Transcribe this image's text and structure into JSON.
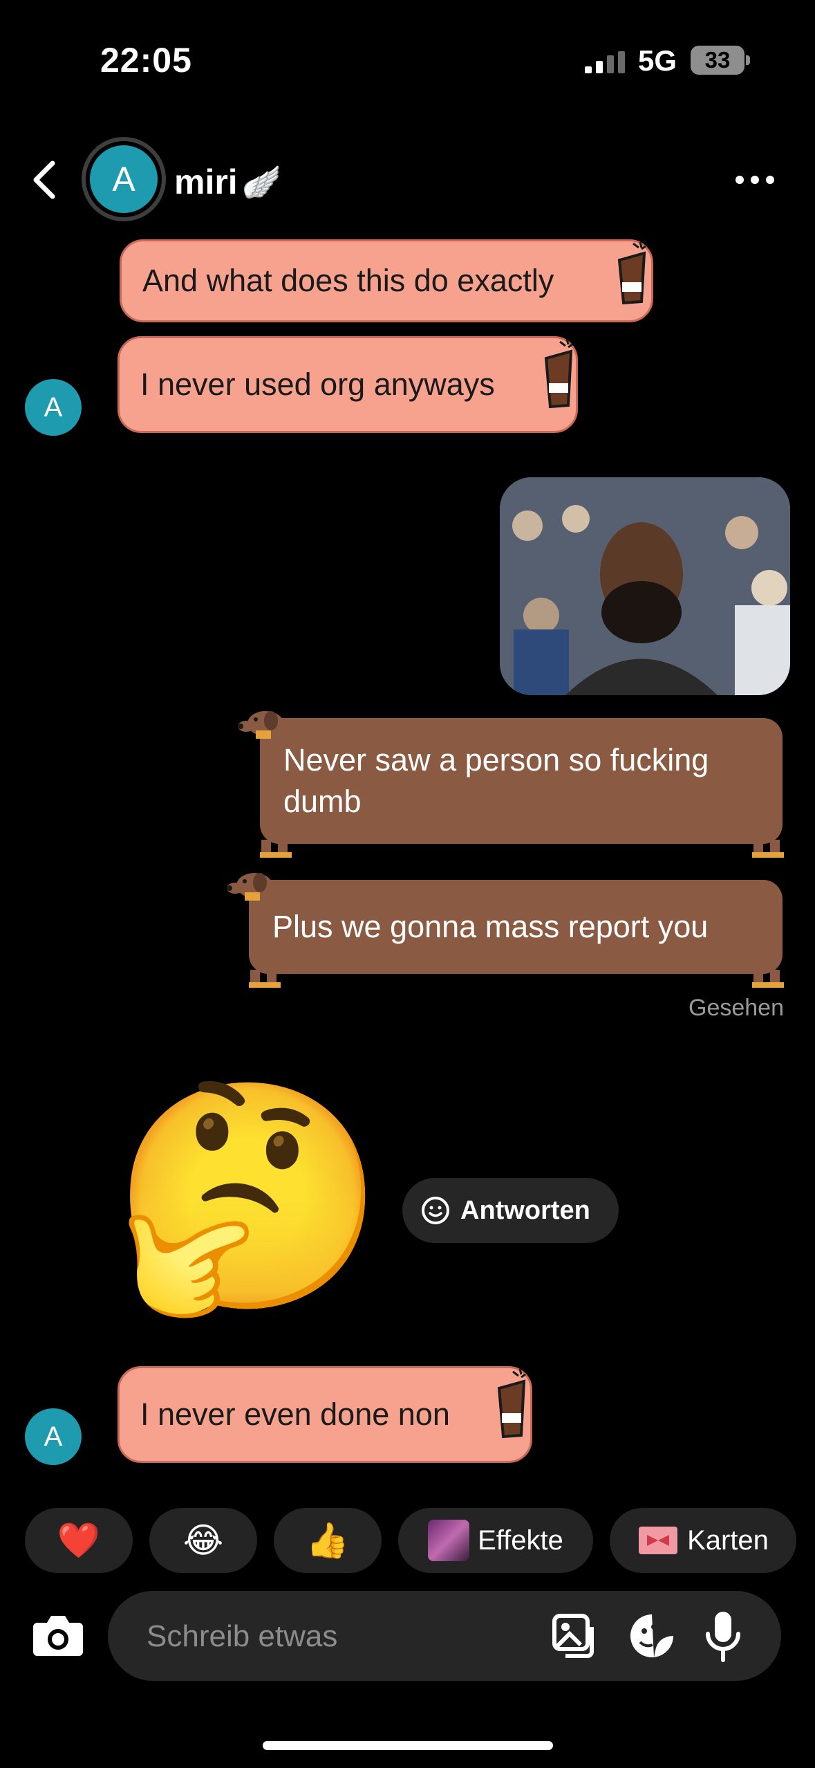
{
  "status_bar": {
    "time": "22:05",
    "network": "5G",
    "battery": "33"
  },
  "header": {
    "avatar_letter": "A",
    "contact_name": "miri",
    "name_emoji": "🪽"
  },
  "messages": [
    {
      "text": "And what does this do exactly",
      "direction": "received"
    },
    {
      "text": "I never used org anyways",
      "direction": "received"
    },
    {
      "text": "Never saw a person so fucking dumb",
      "direction": "sent"
    },
    {
      "text": "Plus we gonna mass report you",
      "direction": "sent"
    },
    {
      "text": "I never even done non",
      "direction": "received"
    }
  ],
  "received_avatar_letter": "A",
  "seen_label": "Gesehen",
  "big_emoji": "🤔",
  "reply_label": "Antworten",
  "quick_reactions": {
    "heart": "❤️",
    "laugh": "😂",
    "thumbs": "👍",
    "effects_label": "Effekte",
    "cards_label": "Karten"
  },
  "composer": {
    "placeholder": "Schreib etwas"
  },
  "colors": {
    "received_bubble": "#f7a28e",
    "sent_bubble": "#8a5a42",
    "avatar": "#1f9bb0"
  }
}
